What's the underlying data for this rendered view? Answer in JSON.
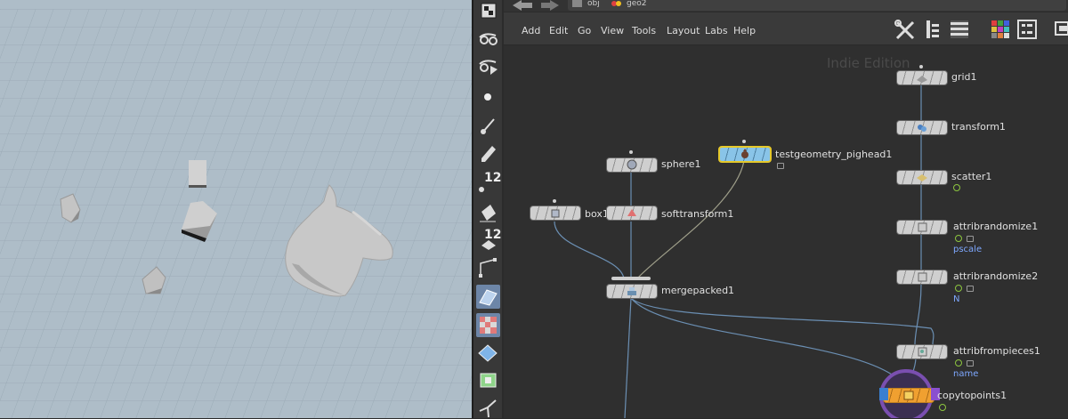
{
  "breadcrumbs": [
    "obj",
    "geo2"
  ],
  "menu": [
    "Add",
    "Edit",
    "Go",
    "View",
    "Tools",
    "Layout",
    "Labs",
    "Help"
  ],
  "watermark": "Indie Edition",
  "toolbar": {
    "badge_1": "12",
    "badge_2": "12"
  },
  "nodes": [
    {
      "label": "grid1"
    },
    {
      "label": "transform1"
    },
    {
      "label": "scatter1"
    },
    {
      "label": "attribrandomize1",
      "attr": "pscale"
    },
    {
      "label": "attribrandomize2",
      "attr": "N"
    },
    {
      "label": "attribfrompieces1",
      "attr": "name"
    },
    {
      "label": "copytopoints1"
    },
    {
      "label": "sphere1"
    },
    {
      "label": "testgeometry_pighead1"
    },
    {
      "label": "box1"
    },
    {
      "label": "softtransform1"
    },
    {
      "label": "mergepacked1"
    }
  ],
  "colors": {
    "viewport_bg": "#a8b8c4",
    "network_bg": "#2f2f2f",
    "selected_node": "#89c4e8",
    "selection_outline": "#e5c82a",
    "attr_text": "#7ea8ff"
  }
}
